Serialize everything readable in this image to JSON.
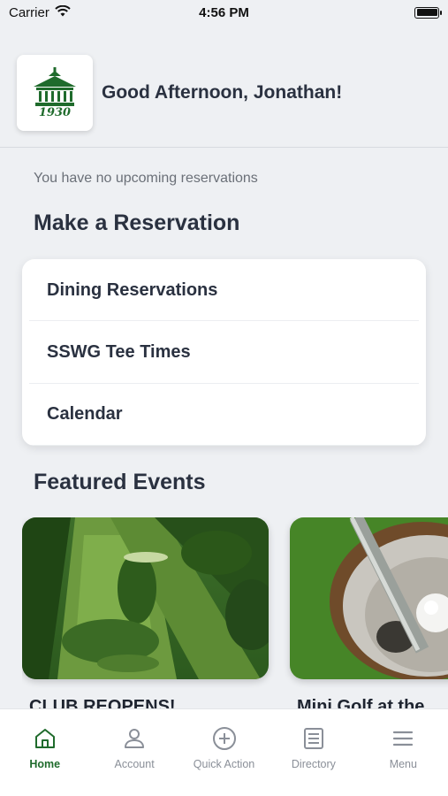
{
  "status_bar": {
    "carrier": "Carrier",
    "time": "4:56 PM"
  },
  "header": {
    "logo_year": "1930",
    "greeting": "Good Afternoon, Jonathan!"
  },
  "reservations": {
    "empty_message": "You have no upcoming reservations"
  },
  "make_reservation": {
    "title": "Make a Reservation",
    "items": [
      {
        "label": "Dining Reservations"
      },
      {
        "label": "SSWG Tee Times"
      },
      {
        "label": "Calendar"
      }
    ]
  },
  "featured_events": {
    "title": "Featured Events",
    "events": [
      {
        "title": "CLUB REOPENS!"
      },
      {
        "title": "Mini Golf at the"
      }
    ]
  },
  "tab_bar": {
    "tabs": [
      {
        "label": "Home",
        "icon": "home-icon",
        "active": true
      },
      {
        "label": "Account",
        "icon": "person-icon"
      },
      {
        "label": "Quick Action",
        "icon": "plus-circle-icon"
      },
      {
        "label": "Directory",
        "icon": "directory-icon"
      },
      {
        "label": "Menu",
        "icon": "menu-icon"
      }
    ]
  },
  "colors": {
    "brand_green": "#1f6b2c",
    "background": "#eef0f3",
    "text": "#2a3140"
  }
}
